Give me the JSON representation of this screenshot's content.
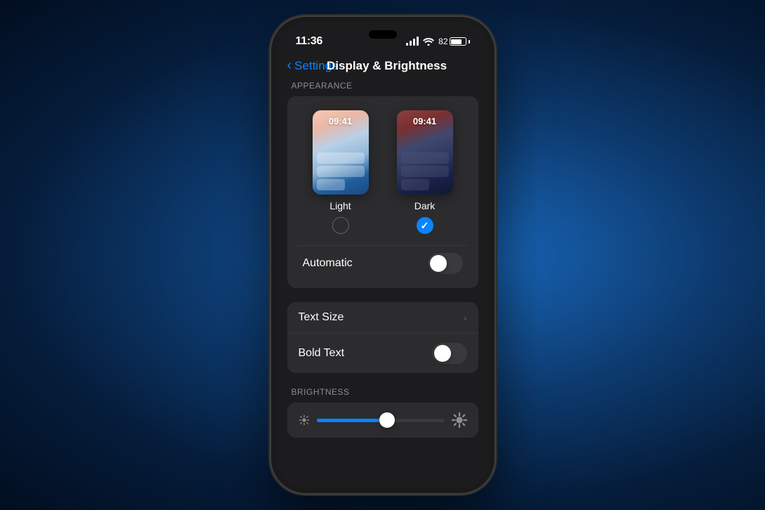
{
  "phone": {
    "status_bar": {
      "time": "11:36",
      "battery_percent": "82"
    },
    "nav": {
      "back_label": "Settings",
      "title": "Display & Brightness"
    },
    "appearance": {
      "section_label": "APPEARANCE",
      "light_option": {
        "label": "Light",
        "preview_time": "09:41",
        "selected": false
      },
      "dark_option": {
        "label": "Dark",
        "preview_time": "09:41",
        "selected": true
      },
      "automatic": {
        "label": "Automatic",
        "enabled": false
      }
    },
    "text_options": {
      "text_size": {
        "label": "Text Size"
      },
      "bold_text": {
        "label": "Bold Text",
        "enabled": false
      }
    },
    "brightness": {
      "section_label": "BRIGHTNESS",
      "slider_value": 55
    }
  },
  "colors": {
    "accent_blue": "#0a84ff",
    "background": "#1c1c1e",
    "card_bg": "#2c2c2e",
    "separator": "#3a3a3c",
    "text_primary": "#ffffff",
    "text_secondary": "#8e8e93"
  }
}
